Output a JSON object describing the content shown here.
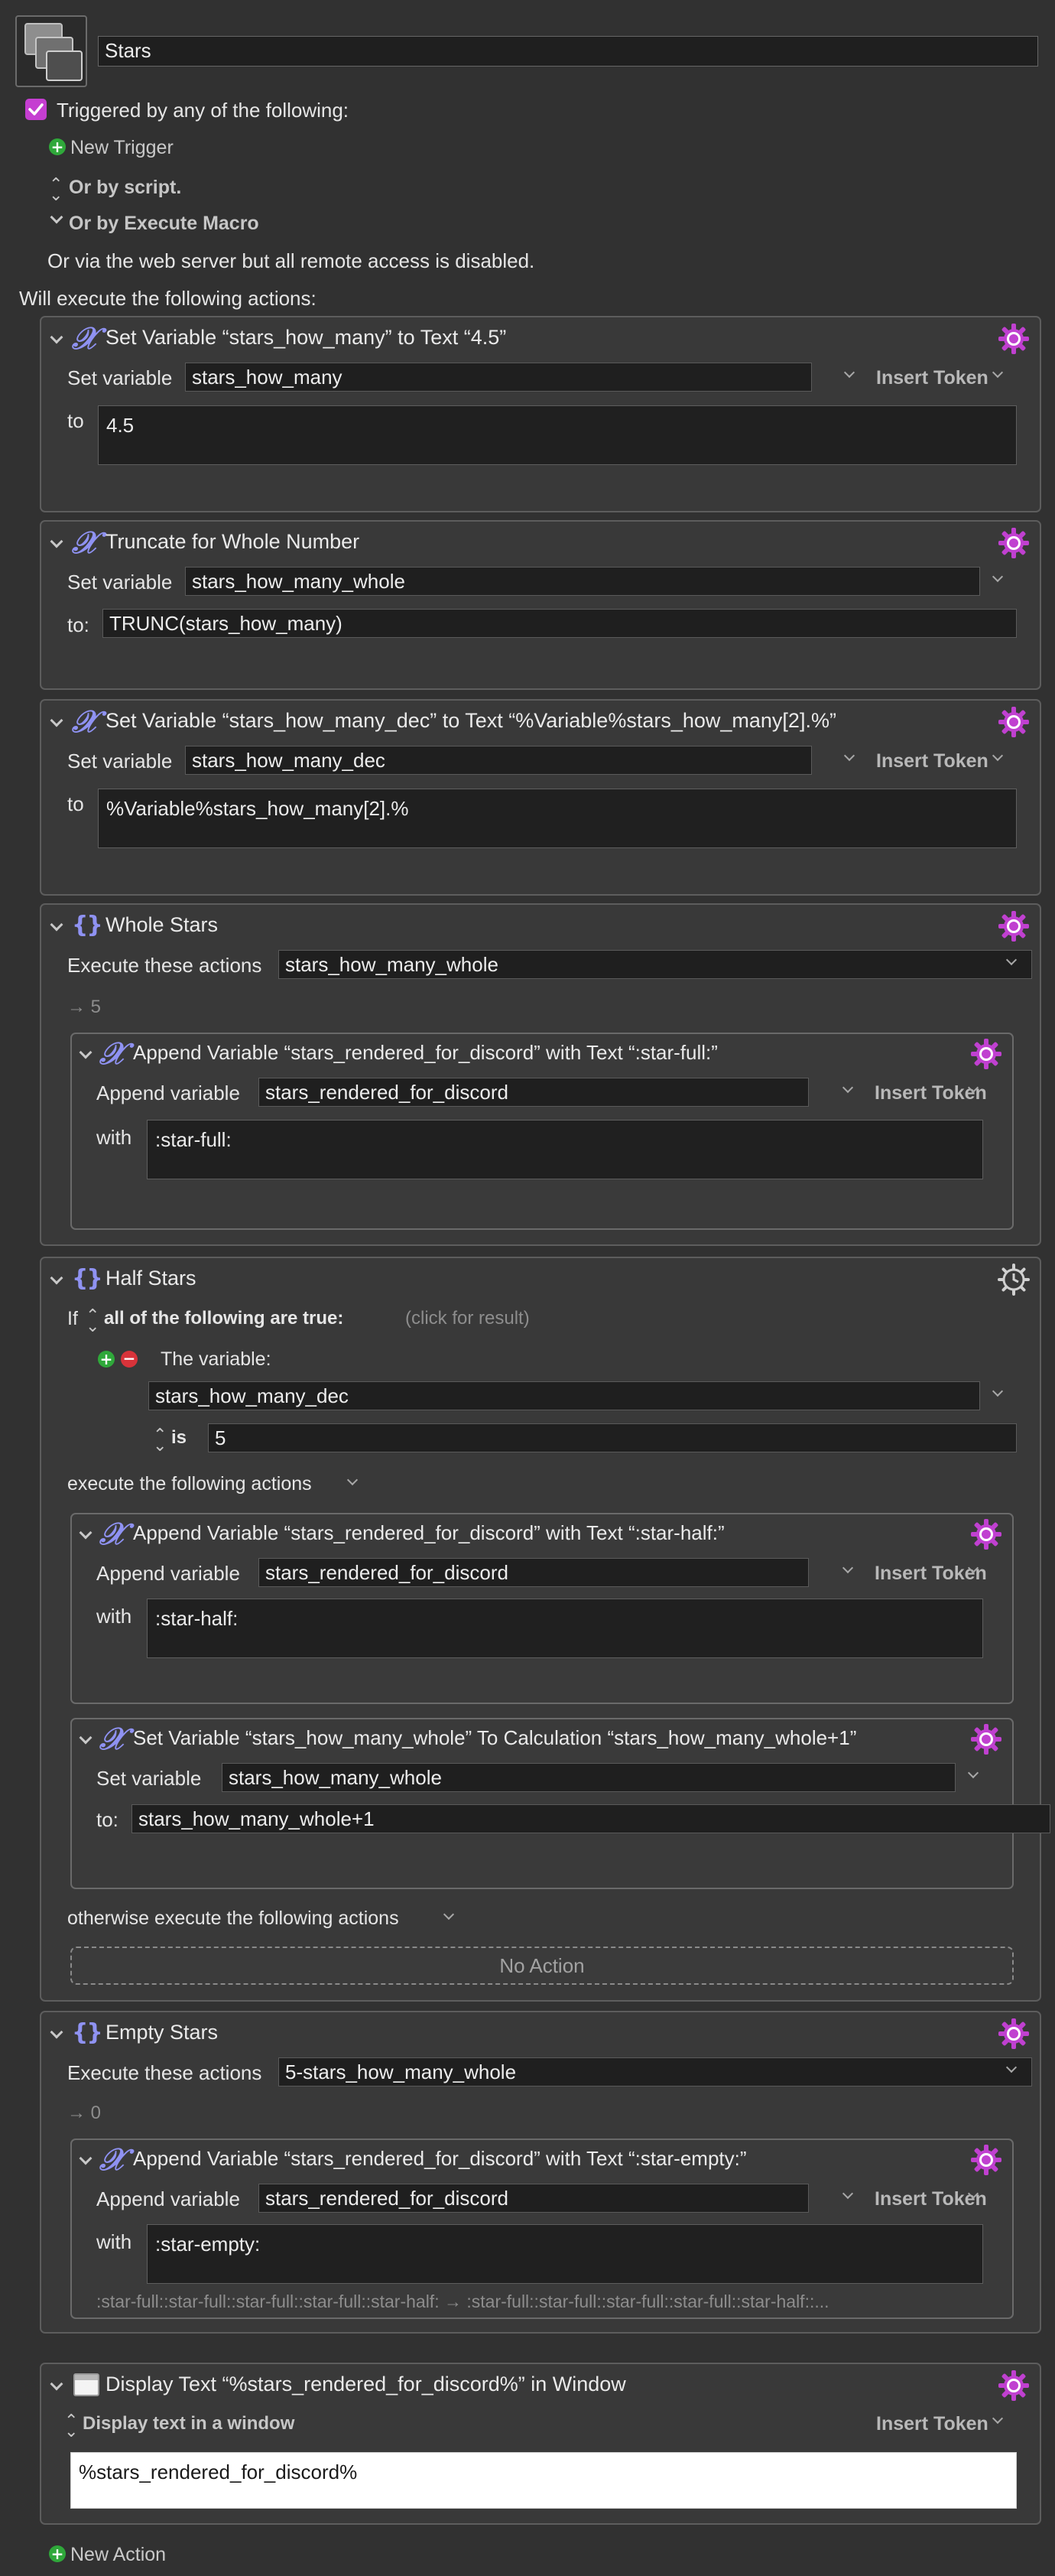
{
  "macro": {
    "name": "Stars",
    "icon": "macro-stack-icon",
    "triggered_label": "Triggered by any of the following:",
    "new_trigger": "New Trigger",
    "or_by_script": "Or by script.",
    "or_by_execute_macro": "Or by Execute Macro",
    "web_server_note": "Or via the web server but all remote access is disabled.",
    "will_execute": "Will execute the following actions:",
    "new_action": "New Action"
  },
  "common": {
    "set_variable": "Set variable",
    "append_variable": "Append variable",
    "insert_token": "Insert Token",
    "to": "to",
    "to_colon": "to:",
    "with": "with",
    "execute_these_actions": "Execute these actions"
  },
  "actions": {
    "a1": {
      "title": "Set Variable “stars_how_many” to Text “4.5”",
      "variable": "stars_how_many",
      "value": "4.5"
    },
    "a2": {
      "title": "Truncate for Whole Number",
      "variable": "stars_how_many_whole",
      "value": "TRUNC(stars_how_many)"
    },
    "a3": {
      "title": "Set Variable “stars_how_many_dec” to Text “%Variable%stars_how_many[2].%”",
      "variable": "stars_how_many_dec",
      "value": "%Variable%stars_how_many[2].%"
    },
    "a4": {
      "title": "Whole Stars",
      "count_expr": "stars_how_many_whole",
      "result": "→ 5",
      "sub": {
        "title": "Append Variable “stars_rendered_for_discord” with Text “:star-full:”",
        "variable": "stars_rendered_for_discord",
        "value": ":star-full:"
      }
    },
    "a5": {
      "title": "Half Stars",
      "if_label": "If",
      "condition_mode": "all of the following are true:",
      "click_for_result": "(click for result)",
      "the_variable": "The variable:",
      "cond_variable": "stars_how_many_dec",
      "is_label": "is",
      "cond_value": "5",
      "execute_following": "execute the following actions",
      "sub1": {
        "title": "Append Variable “stars_rendered_for_discord” with Text “:star-half:”",
        "variable": "stars_rendered_for_discord",
        "value": ":star-half:"
      },
      "sub2": {
        "title": "Set Variable “stars_how_many_whole” To Calculation “stars_how_many_whole+1”",
        "variable": "stars_how_many_whole",
        "value": "stars_how_many_whole+1"
      },
      "otherwise": "otherwise execute the following actions",
      "no_action": "No Action"
    },
    "a6": {
      "title": "Empty Stars",
      "count_expr": "5-stars_how_many_whole",
      "result": "→ 0",
      "sub": {
        "title": "Append Variable “stars_rendered_for_discord” with Text “:star-empty:”",
        "variable": "stars_rendered_for_discord",
        "value": ":star-empty:",
        "preview": ":star-full::star-full::star-full::star-full::star-half: → :star-full::star-full::star-full::star-full::star-half::..."
      }
    },
    "a7": {
      "title": "Display Text “%stars_rendered_for_discord%” in Window",
      "mode": "Display text in a window",
      "value": "%stars_rendered_for_discord%"
    }
  },
  "colors": {
    "accent_icon": "#8f92f2",
    "gear_active": "#c040d0",
    "checkbox": "#c53ed1",
    "background": "#313131"
  }
}
